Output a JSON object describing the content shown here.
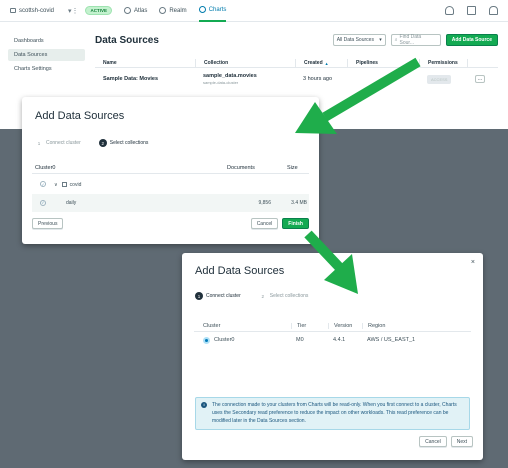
{
  "app": {
    "project": "scottsh-covid",
    "status_badge": "ACTIVE",
    "nav": [
      "Atlas",
      "Realm",
      "Charts"
    ],
    "active_nav": "Charts"
  },
  "sidebar": {
    "items": [
      "Dashboards",
      "Data Sources",
      "Charts Settings"
    ],
    "active": "Data Sources"
  },
  "main": {
    "title": "Data Sources",
    "filter_select": "All Data Sources",
    "search_placeholder": "Find Data Sour...",
    "add_button": "Add Data Source",
    "columns": [
      "Name",
      "Collection",
      "Created",
      "Pipelines",
      "Permissions"
    ],
    "sort_indicator": "▲",
    "rows": [
      {
        "name": "Sample Data: Movies",
        "collection": "sample_data.movies",
        "collection_sub": "sample-data-cluster",
        "created": "3 hours ago",
        "pipelines": "",
        "permissions": "ACCESS",
        "more": "..."
      }
    ]
  },
  "modal_select": {
    "title": "Add Data Sources",
    "steps": [
      {
        "num": "1",
        "label": "Connect cluster"
      },
      {
        "num": "2",
        "label": "Select collections"
      }
    ],
    "columns": [
      "Cluster0",
      "Documents",
      "Size"
    ],
    "database": "covid",
    "collection": {
      "name": "daily",
      "documents": "9,856",
      "size": "3.4 MB"
    },
    "previous": "Previous",
    "cancel": "Cancel",
    "finish": "Finish"
  },
  "modal_connect": {
    "title": "Add Data Sources",
    "close": "×",
    "steps": [
      {
        "num": "1",
        "label": "Connect cluster"
      },
      {
        "num": "2",
        "label": "Select collections"
      }
    ],
    "columns": [
      "Cluster",
      "Tier",
      "Version",
      "Region"
    ],
    "row": {
      "cluster": "Cluster0",
      "tier": "M0",
      "version": "4.4.1",
      "region": "AWS / US_EAST_1"
    },
    "info": "The connection made to your clusters from Charts will be read-only. When you first connect to a cluster, Charts uses the Secondary read preference to reduce the impact on other workloads. This read preference can be modified later in the Data Sources section.",
    "info_icon": "i",
    "cancel": "Cancel",
    "next": "Next"
  },
  "colors": {
    "arrow": "#1fad4b",
    "primary_button": "#13aa52",
    "backdrop": "#5f6a73"
  }
}
